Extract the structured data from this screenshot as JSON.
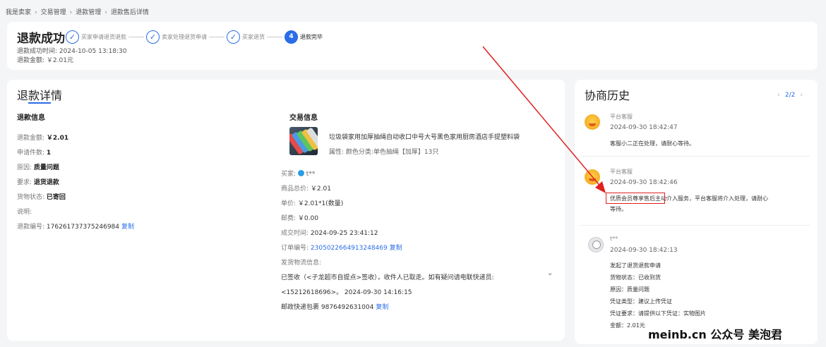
{
  "breadcrumb": [
    "我是卖家",
    "交易管理",
    "退款管理",
    "退款售后详情"
  ],
  "status": {
    "title": "退款成功",
    "steps": [
      {
        "label": "买家申请退货退款",
        "done": true
      },
      {
        "label": "卖家处理退货申请",
        "done": true
      },
      {
        "label": "买家退货",
        "done": true
      },
      {
        "label": "退款完毕",
        "done": false,
        "number": "4"
      }
    ],
    "time_label": "退款成功时间:",
    "time_value": "2024-10-05 13:18:30",
    "amount_label": "退款金额:",
    "amount_value": "￥2.01元"
  },
  "detail": {
    "title_a": "退",
    "title_b": "款详",
    "title_c": "情",
    "refund_info": {
      "heading": "退款信息",
      "amount_label": "退款金额:",
      "amount_value": "￥2.01",
      "count_label": "申请件数:",
      "count_value": "1",
      "reason_label": "原因:",
      "reason_value": "质量问题",
      "request_label": "要求:",
      "request_value": "退货退款",
      "goods_label": "货物状态:",
      "goods_value": "已寄回",
      "note_label": "说明:",
      "refund_no_label": "退款编号:",
      "refund_no_value": "176261737375246984",
      "copy": "复制"
    },
    "trade_info": {
      "heading": "交易信息",
      "product_name": "垃圾袋家用加厚抽绳自动收口中号大号黑色家用厨房酒店手提塑料袋",
      "product_attr": "属性: 颜色分类:单色抽绳【加厚】13只",
      "buyer_label": "买家:",
      "buyer_value": "t**",
      "total_label": "商品总价:",
      "total_value": "￥2.01",
      "unit_label": "单价:",
      "unit_value": "￥2.01*1(数量)",
      "postage_label": "邮费:",
      "postage_value": "￥0.00",
      "deal_time_label": "成交时间:",
      "deal_time_value": "2024-09-25 23:41:12",
      "order_no_label": "订单编号:",
      "order_no_value": "2305022664913248469",
      "copy": "复制",
      "logistics_label": "发货物流信息:",
      "logistics_line1": "已签收（<子龙超市自提点>签收），收件人已取走。如有疑问请电联快递员:",
      "logistics_line2": "<15212618696>。 2024-09-30 14:16:15",
      "express_line": "邮政快递包裹 9876492631004"
    }
  },
  "history": {
    "title": "协商历史",
    "pager": "2/2",
    "entries": [
      {
        "name": "平台客服",
        "time": "2024-09-30 18:42:47",
        "lines": [
          "客服小二正在处理，请耐心等待。"
        ]
      },
      {
        "name": "平台客服",
        "time": "2024-09-30 18:42:46",
        "lines": [
          "优质会员尊享售后主动介入服务，平台客服将介入处理，请耐心",
          "等待。"
        ]
      },
      {
        "name": "t**",
        "time": "2024-09-30 18:42:13",
        "lines": [
          "发起了退货退款申请",
          "货物状态：已收到货",
          "原因：质量问题",
          "凭证类型：建议上传凭证",
          "凭证要求：请提供以下凭证：实物图片",
          "金额：2.01元"
        ]
      }
    ]
  },
  "watermark": "meinb.cn 公众号 美泡君",
  "colors": {
    "accent": "#2b6de8",
    "annotation_red": "#e02020"
  }
}
